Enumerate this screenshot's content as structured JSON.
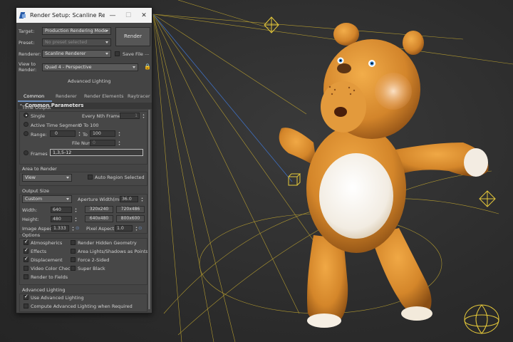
{
  "dialog": {
    "title": "Render Setup: Scanline Rende...",
    "window_buttons": {
      "minimize": "—",
      "maximize": "☐",
      "close": "✕"
    },
    "target": {
      "label": "Target:",
      "value": "Production Rendering Mode"
    },
    "preset": {
      "label": "Preset:",
      "value": "No preset selected"
    },
    "renderer": {
      "label": "Renderer:",
      "value": "Scanline Renderer"
    },
    "save_file": {
      "label": "Save File",
      "checked": false,
      "more": "..."
    },
    "view_to_render": {
      "label_line1": "View to",
      "label_line2": "Render:",
      "value": "Quad 4 - Perspective"
    },
    "render_button": "Render",
    "advanced_lighting_tab": "Advanced Lighting",
    "tabs": [
      {
        "label": "Common",
        "active": true
      },
      {
        "label": "Renderer",
        "active": false
      },
      {
        "label": "Render Elements",
        "active": false
      },
      {
        "label": "Raytracer",
        "active": false
      }
    ],
    "rollout": {
      "toggle": "-",
      "title": "Common Parameters"
    },
    "time_output": {
      "title": "Time Output",
      "single": "Single",
      "every_nth_frame": {
        "label": "Every Nth Frame:",
        "value": "1"
      },
      "active_time_segment": "Active Time Segment:",
      "active_range": "0 To 100",
      "range": {
        "label": "Range:",
        "from": "0",
        "to_label": "To",
        "to": "100"
      },
      "file_number_base": {
        "label": "File Number Base:",
        "value": "0"
      },
      "frames": {
        "label": "Frames",
        "value": "1,3,5-12"
      }
    },
    "area_to_render": {
      "title": "Area to Render",
      "value": "View",
      "auto_region": "Auto Region Selected"
    },
    "output_size": {
      "title": "Output Size",
      "preset": "Custom",
      "aperture": {
        "label": "Aperture Width(mm):",
        "value": "36.0"
      },
      "width": {
        "label": "Width:",
        "value": "640"
      },
      "height": {
        "label": "Height:",
        "value": "480"
      },
      "presets": [
        "320x240",
        "720x486",
        "640x480",
        "800x600"
      ],
      "image_aspect": {
        "label": "Image Aspect:",
        "value": "1.333"
      },
      "pixel_aspect": {
        "label": "Pixel Aspect:",
        "value": "1.0"
      }
    },
    "options": {
      "title": "Options",
      "left": [
        {
          "label": "Atmospherics",
          "checked": true
        },
        {
          "label": "Effects",
          "checked": true
        },
        {
          "label": "Displacement",
          "checked": true
        },
        {
          "label": "Video Color Check",
          "checked": false
        },
        {
          "label": "Render to Fields",
          "checked": false
        }
      ],
      "right": [
        {
          "label": "Render Hidden Geometry",
          "checked": false
        },
        {
          "label": "Area Lights/Shadows as Points",
          "checked": false
        },
        {
          "label": "Force 2-Sided",
          "checked": false
        },
        {
          "label": "Super Black",
          "checked": false
        }
      ]
    },
    "advanced_lighting": {
      "title": "Advanced Lighting",
      "use": {
        "label": "Use Advanced Lighting",
        "checked": true
      },
      "compute": {
        "label": "Compute Advanced Lighting when Required",
        "checked": false
      }
    }
  },
  "colors": {
    "viewport_bg": "#2c2c2c",
    "panel_bg": "#444444",
    "titlebar_bg": "#f3f3f3",
    "wireframe": "#e0c43a",
    "bear_body": "#d88a2a",
    "bear_belly": "#f5efe6"
  }
}
